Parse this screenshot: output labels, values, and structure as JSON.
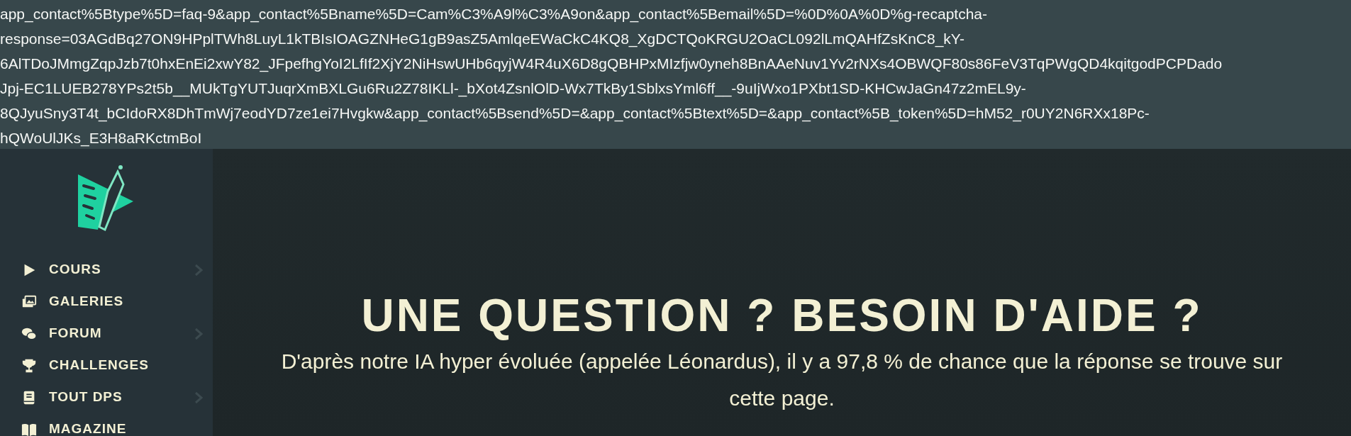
{
  "url_text": {
    "lines": [
      "app_contact%5Btype%5D=faq-9&app_contact%5Bname%5D=Cam%C3%A9l%C3%A9on&app_contact%5Bemail%5D=%0D%0A%0D%g-recaptcha-",
      "response=03AGdBq27ON9HPplTWh8LuyL1kTBIsIOAGZNHeG1gB9asZ5AmlqeEWaCkC4KQ8_XgDCTQoKRGU2OaCL092lLmQAHfZsKnC8_kY-",
      "6AlTDoJMmgZqpJzb7t0hxEnEi2xwY82_JFpefhgYoI2LfIf2XjY2NiHswUHb6qyjW4R4uX6D8gQBHPxMIzfjw0yneh8BnAAeNuv1Yv2rNXs4OBWQF80s86FeV3TqPWgQD4kqitgodPCPDado",
      "Jpj-EC1LUEB278YPs2t5b__MUkTgYUTJuqrXmBXLGu6Ru2Z78IKLl-_bXot4ZsnlOlD-Wx7TkBy1SblxsYml6ff__-9uIjWxo1PXbt1SD-KHCwJaGn47z2mEL9y-",
      "8QJyuSny3T4t_bCIdoRX8DhTmWj7eodYD7ze1ei7Hvgkw&app_contact%5Bsend%5D=&app_contact%5Btext%5D=&app_contact%5B_token%5D=hM52_r0UY2N6RXx18Pc-",
      "hQWoUlJKs_E3H8aRKctmBoI"
    ]
  },
  "sidebar": {
    "items": [
      {
        "kind": "play",
        "label": "COURS",
        "has_submenu": true
      },
      {
        "kind": "gallery",
        "label": "GALERIES",
        "has_submenu": false
      },
      {
        "kind": "chat",
        "label": "FORUM",
        "has_submenu": true
      },
      {
        "kind": "trophy",
        "label": "CHALLENGES",
        "has_submenu": false
      },
      {
        "kind": "book",
        "label": "TOUT DPS",
        "has_submenu": true
      },
      {
        "kind": "magazine",
        "label": "MAGAZINE",
        "has_submenu": false
      }
    ]
  },
  "main": {
    "heading": "UNE QUESTION ? BESOIN D'AIDE ?",
    "intro": "D'après notre IA hyper évoluée (appelée Léonardus), il y a 97,8 % de chance que la réponse se trouve sur cette page."
  }
}
